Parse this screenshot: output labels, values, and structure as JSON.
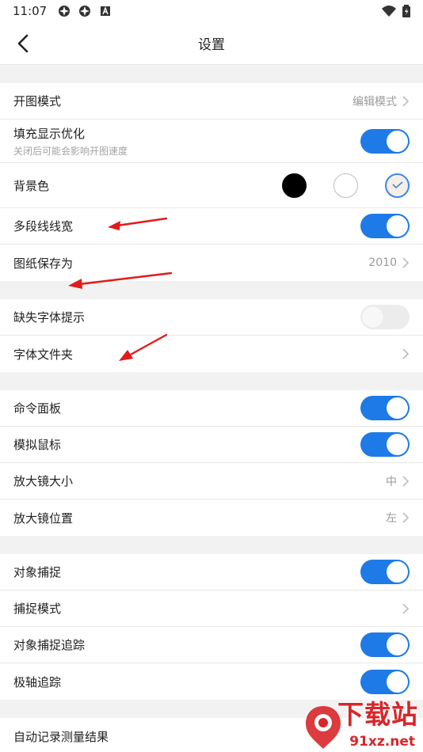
{
  "status_bar": {
    "time": "11:07",
    "left_icons": [
      "app-icon-1",
      "app-icon-2",
      "a-icon"
    ],
    "right_icons": [
      "wifi-icon",
      "battery-icon"
    ]
  },
  "header": {
    "title": "设置",
    "back_icon": "chevron-left-icon"
  },
  "groups": [
    [
      {
        "label": "开图模式",
        "value": "编辑模式",
        "control": "chevron"
      },
      {
        "label": "填充显示优化",
        "sublabel": "关闭后可能会影响开图速度",
        "control": "toggle",
        "on": true
      },
      {
        "label": "背景色",
        "control": "swatches",
        "swatches": [
          "#000000",
          "#ffffff",
          "#f5efe5"
        ],
        "selected": 2
      },
      {
        "label": "多段线线宽",
        "control": "toggle",
        "on": true
      },
      {
        "label": "图纸保存为",
        "value": "2010",
        "control": "chevron"
      }
    ],
    [
      {
        "label": "缺失字体提示",
        "control": "toggle",
        "on": false
      },
      {
        "label": "字体文件夹",
        "control": "chevron"
      }
    ],
    [
      {
        "label": "命令面板",
        "control": "toggle",
        "on": true
      },
      {
        "label": "模拟鼠标",
        "control": "toggle",
        "on": true
      },
      {
        "label": "放大镜大小",
        "value": "中",
        "control": "chevron"
      },
      {
        "label": "放大镜位置",
        "value": "左",
        "control": "chevron"
      }
    ],
    [
      {
        "label": "对象捕捉",
        "control": "toggle",
        "on": true
      },
      {
        "label": "捕捉模式",
        "control": "chevron"
      },
      {
        "label": "对象捕捉追踪",
        "control": "toggle",
        "on": true
      },
      {
        "label": "极轴追踪",
        "control": "toggle",
        "on": true
      }
    ],
    [
      {
        "label": "自动记录测量结果",
        "control": "none"
      }
    ]
  ],
  "colors": {
    "accent": "#1e7ae6",
    "arrow": "#e11b1b"
  },
  "watermark": {
    "title": "下载站",
    "url": "91xz.net"
  }
}
